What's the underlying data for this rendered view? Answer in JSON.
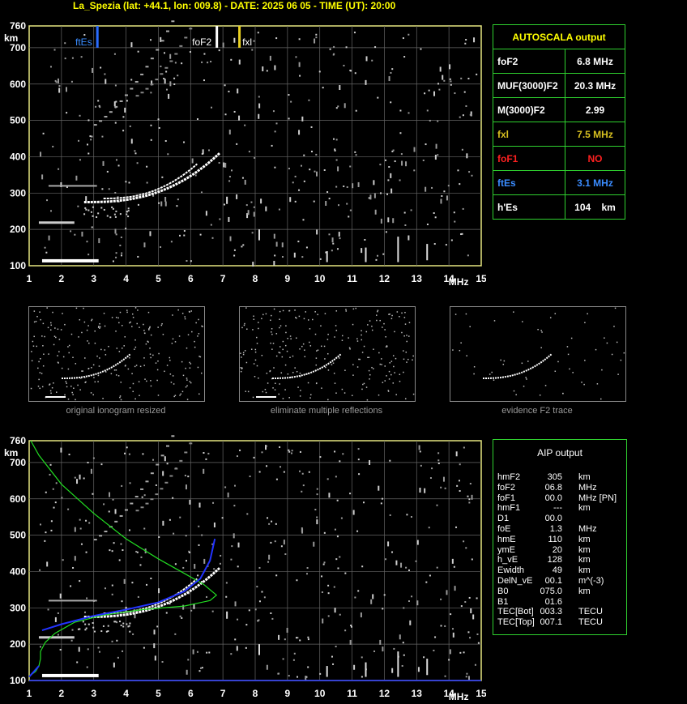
{
  "title": "La_Spezia (lat: +44.1, lon: 009.8) - DATE: 2025 06 05 - TIME (UT): 20:00",
  "axis": {
    "y_ticks": [
      "760",
      "700",
      "600",
      "500",
      "400",
      "300",
      "200",
      "100"
    ],
    "y_unit": "km",
    "x_ticks": [
      "1",
      "2",
      "3",
      "4",
      "5",
      "6",
      "7",
      "8",
      "9",
      "10",
      "11",
      "12",
      "13",
      "14",
      "15"
    ],
    "x_unit": "MHz"
  },
  "markers": {
    "ftEs": "ftEs",
    "foF2": "foF2",
    "fxl": "fxl"
  },
  "autoscala": {
    "header": "AUTOSCALA output",
    "rows": [
      {
        "label": "foF2",
        "value": "6.8 MHz",
        "color": "#ffffff"
      },
      {
        "label": "MUF(3000)F2",
        "value": "20.3 MHz",
        "color": "#ffffff"
      },
      {
        "label": "M(3000)F2",
        "value": "2.99",
        "color": "#ffffff"
      },
      {
        "label": "fxl",
        "value": "7.5 MHz",
        "color": "#d8c020"
      },
      {
        "label": "foF1",
        "value": "NO",
        "color": "#ff2020"
      },
      {
        "label": "ftEs",
        "value": "3.1 MHz",
        "color": "#3a8cff"
      },
      {
        "label": "h'Es",
        "value": "104    km",
        "color": "#ffffff"
      }
    ]
  },
  "thumbs": {
    "c1": "original ionogram resized",
    "c2": "eliminate multiple reflections",
    "c3": "evidence F2 trace"
  },
  "aip": {
    "header": "AIP output",
    "rows": [
      {
        "k": "hmF2",
        "v": "305",
        "u": "km"
      },
      {
        "k": "foF2",
        "v": "06.8",
        "u": "MHz"
      },
      {
        "k": "foF1",
        "v": "00.0",
        "u": "MHz   [PN]"
      },
      {
        "k": "hmF1",
        "v": "---",
        "u": "km"
      },
      {
        "k": "D1",
        "v": "00.0",
        "u": ""
      },
      {
        "k": "foE",
        "v": "1.3",
        "u": "MHz"
      },
      {
        "k": "hmE",
        "v": "110",
        "u": "km"
      },
      {
        "k": "ymE",
        "v": "20",
        "u": "km"
      },
      {
        "k": "h_vE",
        "v": "128",
        "u": "km"
      },
      {
        "k": "Ewidth",
        "v": "49",
        "u": "km"
      },
      {
        "k": "DelN_vE",
        "v": "00.1",
        "u": "m^(-3)"
      },
      {
        "k": "B0",
        "v": "075.0",
        "u": "km"
      },
      {
        "k": "B1",
        "v": "01.6",
        "u": ""
      },
      {
        "k": "TEC[Bot]",
        "v": "003.3",
        "u": "TECU"
      },
      {
        "k": "TEC[Top]",
        "v": "007.1",
        "u": "TECU"
      }
    ]
  }
}
